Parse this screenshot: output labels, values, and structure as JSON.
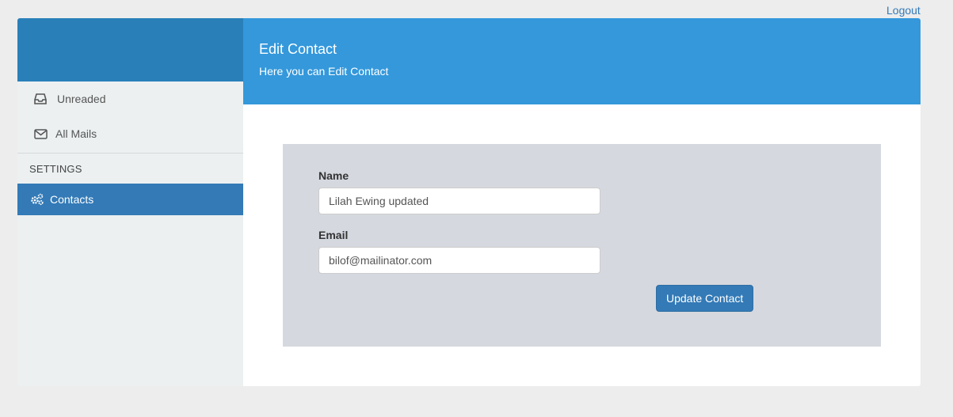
{
  "topbar": {
    "logout_label": "Logout"
  },
  "sidebar": {
    "items": [
      {
        "label": "Unreaded",
        "icon": "inbox-icon"
      },
      {
        "label": "All Mails",
        "icon": "envelope-icon"
      }
    ],
    "settings_header": "SETTINGS",
    "settings_items": [
      {
        "label": "Contacts",
        "icon": "gears-icon",
        "active": true
      }
    ]
  },
  "header": {
    "title": "Edit Contact",
    "subtitle": "Here you can Edit Contact"
  },
  "form": {
    "name_label": "Name",
    "name_value": "Lilah Ewing updated",
    "email_label": "Email",
    "email_value": "bilof@mailinator.com",
    "submit_label": "Update Contact"
  },
  "colors": {
    "brand": "#2980b9",
    "header": "#3498db",
    "active": "#337ab7",
    "sidebar_bg": "#ecf0f1",
    "form_panel": "#d5d8df"
  }
}
